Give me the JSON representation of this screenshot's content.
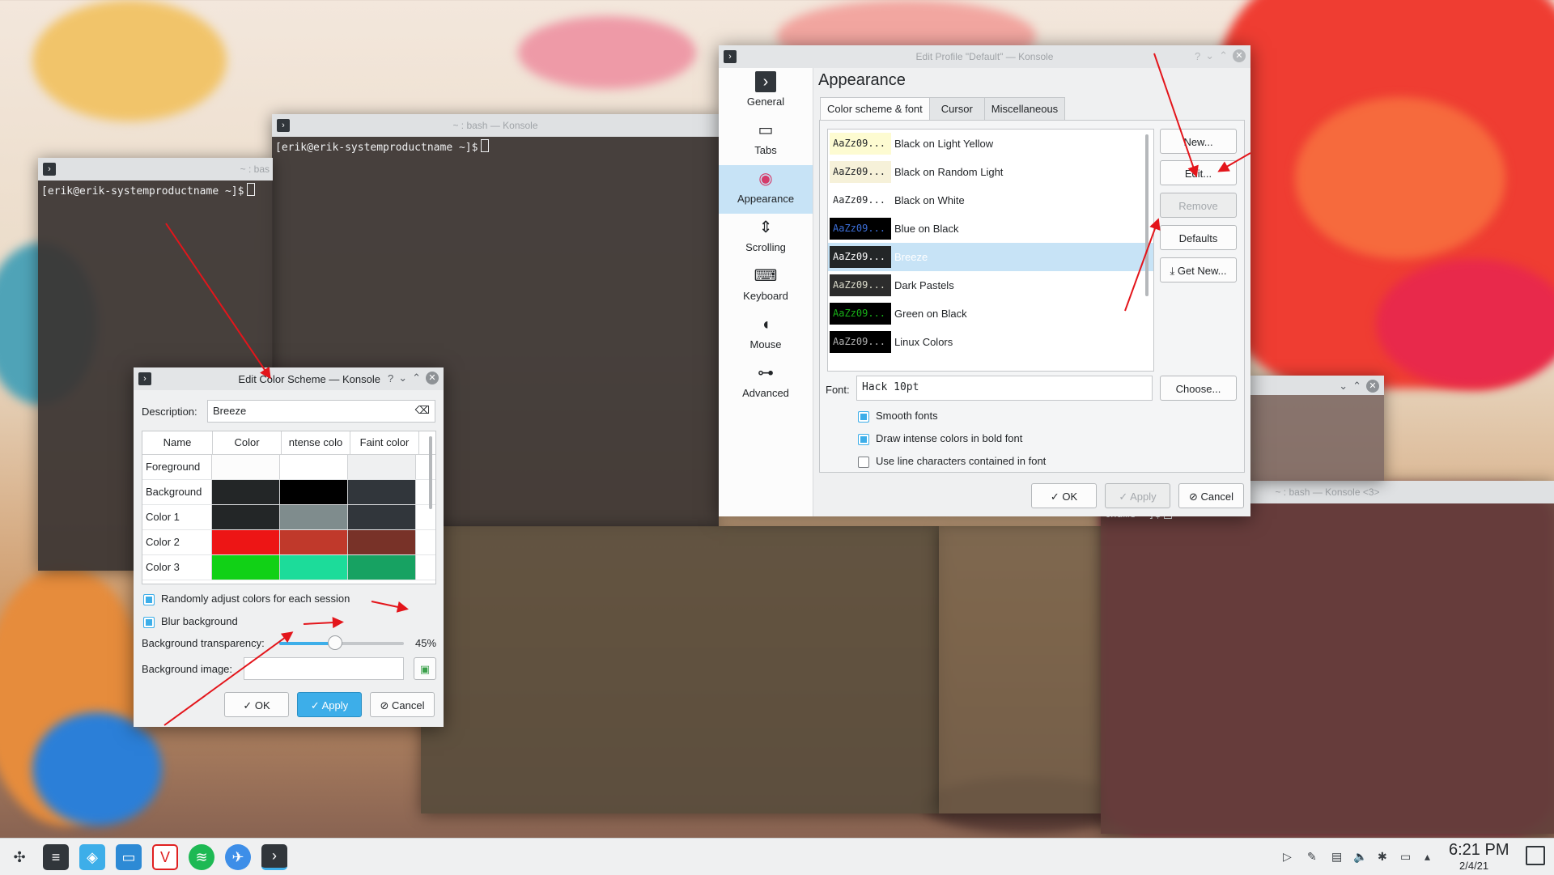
{
  "desktop": {
    "bg_accent": "#e9392f"
  },
  "terminal_back": {
    "title": "~ : bash — Konsole",
    "prompt": "[erik@erik-systemproductname ~]$"
  },
  "terminal_left": {
    "title": "~ : bas",
    "prompt": "[erik@erik-systemproductname ~]$"
  },
  "terminal_right": {
    "title": "~ : bash — Konsole <3>",
    "prompt": "tname ~]$"
  },
  "edit_profile": {
    "title": "Edit Profile \"Default\" — Konsole",
    "nav": [
      {
        "label": "General",
        "icon": "terminal-icon"
      },
      {
        "label": "Tabs",
        "icon": "tabs-icon"
      },
      {
        "label": "Appearance",
        "icon": "color-wheel-icon"
      },
      {
        "label": "Scrolling",
        "icon": "scroll-icon"
      },
      {
        "label": "Keyboard",
        "icon": "keyboard-icon"
      },
      {
        "label": "Mouse",
        "icon": "mouse-icon"
      },
      {
        "label": "Advanced",
        "icon": "sliders-icon"
      }
    ],
    "heading": "Appearance",
    "tabs": [
      "Color scheme & font",
      "Cursor",
      "Miscellaneous"
    ],
    "schemes": [
      {
        "sample": "AaZz09...",
        "name": "Black on Light Yellow",
        "bg": "#fdfbd1",
        "fg": "#232629"
      },
      {
        "sample": "AaZz09...",
        "name": "Black on Random Light",
        "bg": "#f6f1d9",
        "fg": "#232629"
      },
      {
        "sample": "AaZz09...",
        "name": "Black on White",
        "bg": "#ffffff",
        "fg": "#232629"
      },
      {
        "sample": "AaZz09...",
        "name": "Blue on Black",
        "bg": "#000000",
        "fg": "#3c6fd8"
      },
      {
        "sample": "AaZz09...",
        "name": "Breeze",
        "bg": "#232627",
        "fg": "#fcfcfc"
      },
      {
        "sample": "AaZz09...",
        "name": "Dark Pastels",
        "bg": "#2c2c2c",
        "fg": "#dcdccc"
      },
      {
        "sample": "AaZz09...",
        "name": "Green on Black",
        "bg": "#000000",
        "fg": "#18b218"
      },
      {
        "sample": "AaZz09...",
        "name": "Linux Colors",
        "bg": "#000000",
        "fg": "#b2b2b2"
      }
    ],
    "buttons": {
      "new": "New...",
      "edit": "Edit...",
      "remove": "Remove",
      "defaults": "Defaults",
      "get_new": "Get New...",
      "choose": "Choose..."
    },
    "font_label": "Font:",
    "font_value": "Hack 10pt",
    "checks": [
      {
        "label": "Smooth fonts",
        "checked": true
      },
      {
        "label": "Draw intense colors in bold font",
        "checked": true
      },
      {
        "label": "Use line characters contained in font",
        "checked": false
      }
    ],
    "footer": {
      "ok": "OK",
      "apply": "Apply",
      "cancel": "Cancel"
    }
  },
  "edit_scheme": {
    "title": "Edit Color Scheme — Konsole",
    "description_label": "Description:",
    "description_value": "Breeze",
    "columns": [
      "Name",
      "Color",
      "ntense colo",
      "Faint color"
    ],
    "rows": [
      {
        "name": "Foreground",
        "c": "#fcfcfc",
        "i": "#ffffff",
        "f": "#eff0f1"
      },
      {
        "name": "Background",
        "c": "#232627",
        "i": "#000000",
        "f": "#31363b"
      },
      {
        "name": "Color 1",
        "c": "#232627",
        "i": "#7f8c8d",
        "f": "#31363b"
      },
      {
        "name": "Color 2",
        "c": "#ed1515",
        "i": "#c0392b",
        "f": "#783228"
      },
      {
        "name": "Color 3",
        "c": "#11d116",
        "i": "#1cdc9a",
        "f": "#17a262"
      }
    ],
    "random_label": "Randomly adjust colors for each session",
    "blur_label": "Blur background",
    "transparency_label": "Background transparency:",
    "transparency_value": "45%",
    "transparency_fraction": 0.45,
    "bgimage_label": "Background image:",
    "footer": {
      "ok": "OK",
      "apply": "Apply",
      "cancel": "Cancel"
    }
  },
  "taskbar": {
    "clock": "6:21 PM",
    "date": "2/4/21"
  }
}
